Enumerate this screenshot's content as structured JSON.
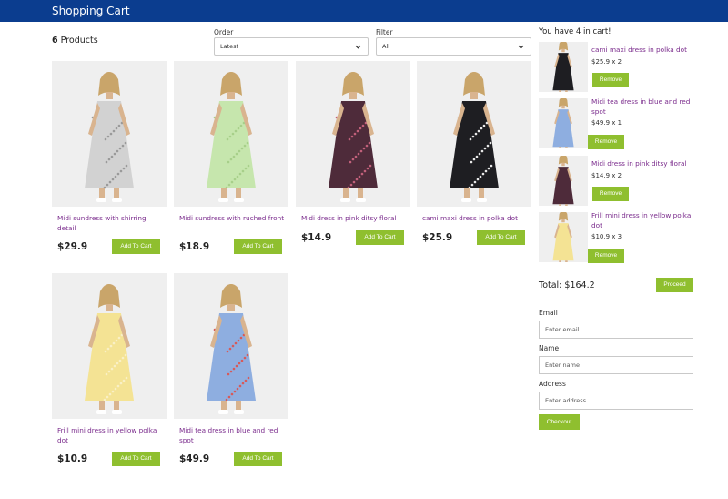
{
  "header": {
    "title": "Shopping Cart"
  },
  "products_count": {
    "number": "6",
    "label": "Products"
  },
  "order": {
    "label": "Order",
    "selected": "Latest"
  },
  "filter": {
    "label": "Filter",
    "selected": "All"
  },
  "products": [
    {
      "name": "Midi sundress with shirring detail",
      "price": "$29.9",
      "button": "Add To Cart",
      "dress_color": "#d2d2d2",
      "pattern_color": "#9a9a9a"
    },
    {
      "name": "Midi sundress with ruched front",
      "price": "$18.9",
      "button": "Add To Cart",
      "dress_color": "#c6e6ad",
      "pattern_color": "#a7cf8a"
    },
    {
      "name": "Midi dress in pink ditsy floral",
      "price": "$14.9",
      "button": "Add To Cart",
      "dress_color": "#4e2b3a",
      "pattern_color": "#c1607a"
    },
    {
      "name": "cami maxi dress in polka dot",
      "price": "$25.9",
      "button": "Add To Cart",
      "dress_color": "#1e1e22",
      "pattern_color": "#e8e8e8"
    },
    {
      "name": "Frill mini dress in yellow polka dot",
      "price": "$10.9",
      "button": "Add To Cart",
      "dress_color": "#f4e394",
      "pattern_color": "#f9f0c6"
    },
    {
      "name": "Midi tea dress in blue and red spot",
      "price": "$49.9",
      "button": "Add To Cart",
      "dress_color": "#8eaee0",
      "pattern_color": "#d65a5a"
    }
  ],
  "cart": {
    "heading": "You have 4 in cart!",
    "items": [
      {
        "name": "cami maxi dress in polka dot",
        "qty": "$25.9 x 2",
        "button": "Remove",
        "dress_color": "#1e1e22"
      },
      {
        "name": "Midi tea dress in blue and red spot",
        "qty": "$49.9 x 1",
        "button": "Remove",
        "dress_color": "#8eaee0"
      },
      {
        "name": "Midi dress in pink ditsy floral",
        "qty": "$14.9 x 2",
        "button": "Remove",
        "dress_color": "#4e2b3a"
      },
      {
        "name": "Frill mini dress in yellow polka dot",
        "qty": "$10.9 x 3",
        "button": "Remove",
        "dress_color": "#f4e394"
      }
    ],
    "total": "Total: $164.2",
    "proceed": "Proceed"
  },
  "checkout_form": {
    "email_label": "Email",
    "email_placeholder": "Enter email",
    "name_label": "Name",
    "name_placeholder": "Enter name",
    "address_label": "Address",
    "address_placeholder": "Enter address",
    "checkout_button": "Checkout"
  },
  "colors": {
    "header_bg": "#0b3d8f",
    "button_green": "#8fbf2f",
    "product_name": "#7a2b8c"
  },
  "icons": {
    "select_arrow": "chevron-down-icon"
  }
}
